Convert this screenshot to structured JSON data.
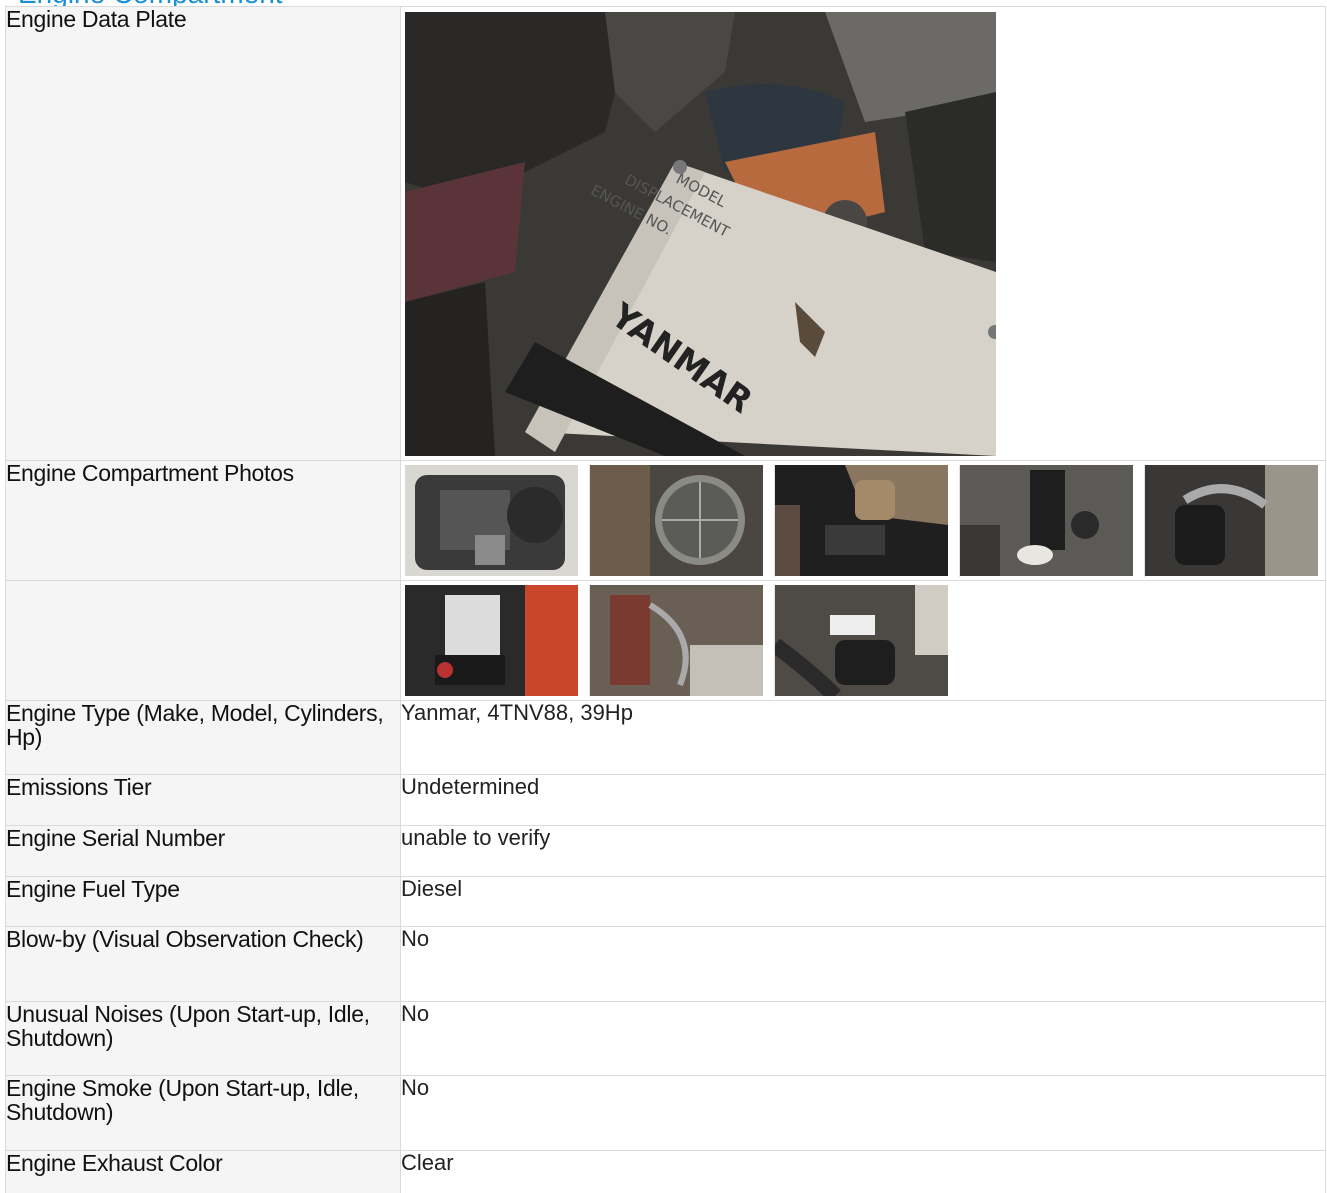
{
  "section": {
    "heading": "Engine Compartment"
  },
  "rows": {
    "data_plate": {
      "label": "Engine Data Plate",
      "plate_text": {
        "model": "MODEL",
        "displacement": "DISPLACEMENT",
        "engine_no": "ENGINE NO.",
        "brand": "YANMAR"
      }
    },
    "compartment_photos": {
      "label": "Engine Compartment Photos",
      "row1_count": 5,
      "row2_count": 3
    },
    "engine_type": {
      "label": "Engine Type (Make, Model, Cylinders, Hp)",
      "value": "Yanmar, 4TNV88, 39Hp"
    },
    "emissions_tier": {
      "label": "Emissions Tier",
      "value": "Undetermined"
    },
    "serial_number": {
      "label": "Engine Serial Number",
      "value": "unable to verify"
    },
    "fuel_type": {
      "label": "Engine Fuel Type",
      "value": "Diesel"
    },
    "blow_by": {
      "label": "Blow-by (Visual Observation Check)",
      "value": "No"
    },
    "unusual_noises": {
      "label": "Unusual Noises (Upon Start-up, Idle, Shutdown)",
      "value": "No"
    },
    "engine_smoke": {
      "label": "Engine Smoke (Upon Start-up, Idle, Shutdown)",
      "value": "No"
    },
    "exhaust_color": {
      "label": "Engine Exhaust Color",
      "value": "Clear"
    }
  },
  "colors": {
    "heading": "#1a8fd6",
    "label_bg": "#f5f5f5",
    "border": "#dadada"
  }
}
